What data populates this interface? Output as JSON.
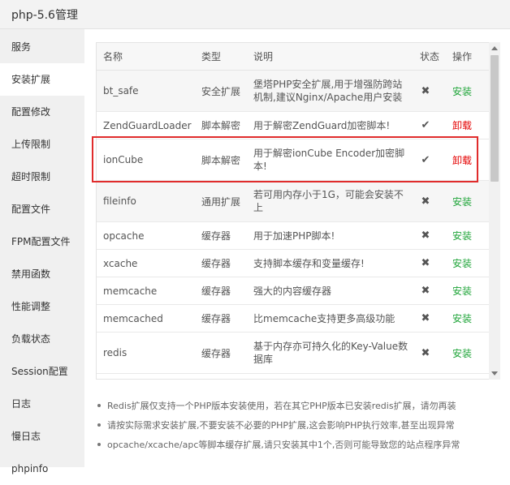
{
  "window": {
    "title": "php-5.6管理"
  },
  "sidebar": {
    "items": [
      {
        "label": "服务",
        "active": false
      },
      {
        "label": "安装扩展",
        "active": true
      },
      {
        "label": "配置修改",
        "active": false
      },
      {
        "label": "上传限制",
        "active": false
      },
      {
        "label": "超时限制",
        "active": false
      },
      {
        "label": "配置文件",
        "active": false
      },
      {
        "label": "FPM配置文件",
        "active": false
      },
      {
        "label": "禁用函数",
        "active": false
      },
      {
        "label": "性能调整",
        "active": false
      },
      {
        "label": "负载状态",
        "active": false
      },
      {
        "label": "Session配置",
        "active": false
      },
      {
        "label": "日志",
        "active": false
      },
      {
        "label": "慢日志",
        "active": false
      },
      {
        "label": "phpinfo",
        "active": false
      }
    ]
  },
  "table": {
    "headers": {
      "name": "名称",
      "type": "类型",
      "desc": "说明",
      "status": "状态",
      "op": "操作"
    },
    "rows": [
      {
        "name": "bt_safe",
        "type": "安全扩展",
        "desc": "堡塔PHP安全扩展,用于增强防跨站机制,建议Nginx/Apache用户安装",
        "status": "✖",
        "op": "安装",
        "op_kind": "install"
      },
      {
        "name": "ZendGuardLoader",
        "type": "脚本解密",
        "desc": "用于解密ZendGuard加密脚本!",
        "status": "✔",
        "op": "卸载",
        "op_kind": "uninstall"
      },
      {
        "name": "ionCube",
        "type": "脚本解密",
        "desc": "用于解密ionCube Encoder加密脚本!",
        "status": "✔",
        "op": "卸载",
        "op_kind": "uninstall"
      },
      {
        "name": "fileinfo",
        "type": "通用扩展",
        "desc": "若可用内存小于1G，可能会安装不上",
        "status": "✖",
        "op": "安装",
        "op_kind": "install"
      },
      {
        "name": "opcache",
        "type": "缓存器",
        "desc": "用于加速PHP脚本!",
        "status": "✖",
        "op": "安装",
        "op_kind": "install"
      },
      {
        "name": "xcache",
        "type": "缓存器",
        "desc": "支持脚本缓存和变量缓存!",
        "status": "✖",
        "op": "安装",
        "op_kind": "install"
      },
      {
        "name": "memcache",
        "type": "缓存器",
        "desc": "强大的内容缓存器",
        "status": "✖",
        "op": "安装",
        "op_kind": "install"
      },
      {
        "name": "memcached",
        "type": "缓存器",
        "desc": "比memcache支持更多高级功能",
        "status": "✖",
        "op": "安装",
        "op_kind": "install"
      },
      {
        "name": "redis",
        "type": "缓存器",
        "desc": "基于内存亦可持久化的Key-Value数据库",
        "status": "✖",
        "op": "安装",
        "op_kind": "install"
      }
    ]
  },
  "notes": [
    "Redis扩展仅支持一个PHP版本安装使用，若在其它PHP版本已安装redis扩展，请勿再装",
    "请按实际需求安装扩展,不要安装不必要的PHP扩展,这会影响PHP执行效率,甚至出现异常",
    "opcache/xcache/apc等脚本缓存扩展,请只安装其中1个,否则可能导致您的站点程序异常"
  ],
  "colors": {
    "install": "#20a53a",
    "uninstall": "#e40000",
    "highlight": "#e02c2c"
  }
}
